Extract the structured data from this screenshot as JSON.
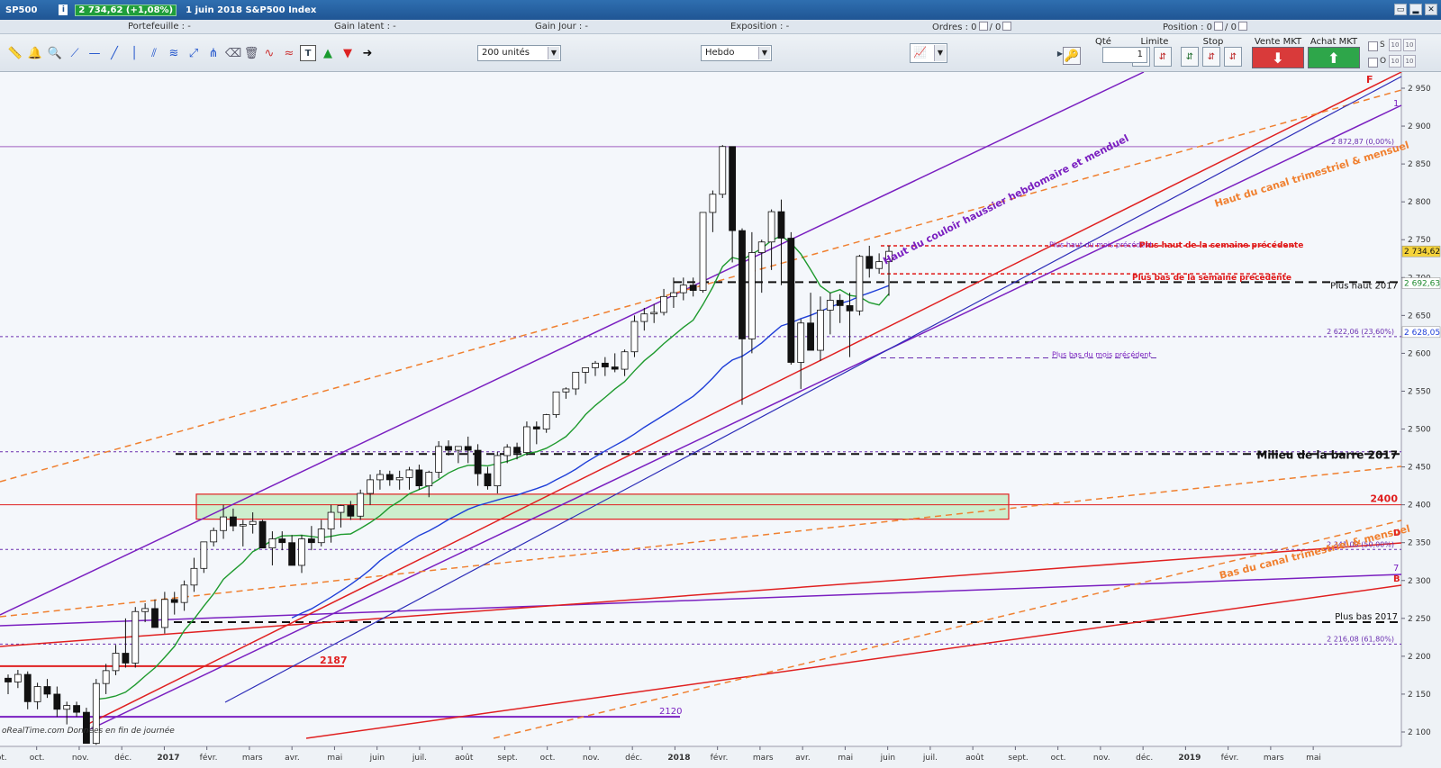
{
  "title_bar": {
    "symbol": "SP500",
    "info_icon": "info-icon",
    "price_badge": "2 734,62 (+1,08%)",
    "description": "1 juin 2018  S&P500 Index",
    "window_buttons": [
      "restore-icon",
      "minimize-icon",
      "close-icon"
    ]
  },
  "stats": {
    "portefeuille": "Portefeuille : -",
    "gain_latent": "Gain latent : -",
    "gain_jour": "Gain Jour : -",
    "exposition": "Exposition : -",
    "ordres_label": "Ordres : 0",
    "ordres_sep": "/ 0",
    "position_label": "Position : 0",
    "position_sep": "/ 0"
  },
  "toolbar": {
    "tools": [
      "ruler-icon",
      "alert-bell-icon",
      "zoom-icon",
      "trendline-icon",
      "horizontal-line-icon",
      "line-icon",
      "vertical-line-icon",
      "parallel-channel-icon",
      "fibonacci-icon",
      "arrows-icon",
      "pitchfork-icon",
      "delete-icon",
      "indicator-icon",
      "waves-icon",
      "text-icon",
      "buy-arrow-icon",
      "sell-arrow-icon",
      "right-arrow-icon"
    ],
    "units_select": "200 unités",
    "period_select": "Hebdo",
    "chart_type_icon": "candlestick-chart-icon",
    "qty_header": "Qté",
    "qty_value": "1",
    "limite_header": "Limite",
    "stop_header": "Stop",
    "vente_header": "Vente MKT",
    "achat_header": "Achat MKT",
    "s_label": "S",
    "o_label": "O",
    "spin_value": "10"
  },
  "chart_data": {
    "type": "candlestick",
    "period": "Hebdo",
    "ylim": [
      2080,
      2970
    ],
    "y_ticks": [
      "2 950",
      "2 900",
      "2 850",
      "2 800",
      "2 750",
      "2 700",
      "2 650",
      "2 600",
      "2 550",
      "2 500",
      "2 450",
      "2 400",
      "2 350",
      "2 300",
      "2 250",
      "2 200",
      "2 150",
      "2 100"
    ],
    "x_ticks": [
      "sept.",
      "oct.",
      "nov.",
      "déc.",
      "2017",
      "févr.",
      "mars",
      "avr.",
      "mai",
      "juin",
      "juil.",
      "août",
      "sept.",
      "oct.",
      "nov.",
      "déc.",
      "2018",
      "févr.",
      "mars",
      "avr.",
      "mai",
      "juin",
      "juil.",
      "août",
      "sept.",
      "oct.",
      "nov.",
      "déc.",
      "2019",
      "févr.",
      "mars",
      "mai"
    ],
    "last_price_label": "2 734,62",
    "ma_green_label": "2 692,63",
    "ma_blue_label": "2 628,05",
    "fibo_labels": {
      "top": "2 872,87 (0,00%)",
      "f236": "2 622,06 (23,60%)",
      "f50": "2 341,00 (50,00%)",
      "f618": "2 216,08 (61,80%)"
    },
    "annotations": {
      "haut_couloir": "Haut du couloir haussier hebdomaire et menduel",
      "haut_canal": "Haut du canal trimestriel & mensuel",
      "bas_canal": "Bas du canal trimestriel & mensuel",
      "plus_haut_semaine": "Plus haut de la semaine précédente",
      "plus_bas_semaine": "Plus bas de la semaine précédente",
      "plus_haut_mois": "Plus haut du mois précédent",
      "plus_bas_mois": "Plus bas du mois précédent",
      "plus_haut_2017": "Plus haut 2017",
      "milieu_barre": "Milieu de la barre 2017",
      "plus_bas_2017": "Plus bas 2017",
      "zone_2400": "2400",
      "level_2187": "2187",
      "level_2120": "2120",
      "letter_f": "F",
      "letter_1": "1",
      "letter_7": "7",
      "letter_b": "B",
      "letter_d": "D"
    },
    "levels": {
      "top_fibo": 2872.87,
      "plus_haut_mois": 2742,
      "plus_haut_semaine": 2742,
      "plus_bas_semaine": 2705,
      "plus_haut_2017": 2694,
      "fibo_236": 2622.06,
      "plus_bas_mois": 2594,
      "milieu_barre": 2467,
      "fibo_dotted_2468": 2470,
      "zone_2400_low": 2381,
      "zone_2400_high": 2414,
      "line_2400": 2400,
      "fibo_50": 2341,
      "plus_bas_2017": 2245,
      "fibo_618": 2216.08,
      "level_2187": 2187,
      "level_2120": 2120
    },
    "candles": [
      [
        2171,
        2176,
        2150,
        2166
      ],
      [
        2166,
        2182,
        2158,
        2176
      ],
      [
        2176,
        2180,
        2130,
        2140
      ],
      [
        2140,
        2165,
        2130,
        2160
      ],
      [
        2160,
        2170,
        2145,
        2150
      ],
      [
        2150,
        2160,
        2120,
        2130
      ],
      [
        2130,
        2140,
        2110,
        2135
      ],
      [
        2135,
        2140,
        2120,
        2126
      ],
      [
        2126,
        2132,
        2100,
        2085
      ],
      [
        2085,
        2170,
        2083,
        2164
      ],
      [
        2164,
        2190,
        2150,
        2181
      ],
      [
        2181,
        2215,
        2175,
        2204
      ],
      [
        2204,
        2250,
        2185,
        2191
      ],
      [
        2191,
        2265,
        2185,
        2259
      ],
      [
        2259,
        2270,
        2245,
        2263
      ],
      [
        2263,
        2275,
        2240,
        2238
      ],
      [
        2238,
        2285,
        2230,
        2275
      ],
      [
        2275,
        2285,
        2255,
        2271
      ],
      [
        2271,
        2300,
        2260,
        2294
      ],
      [
        2294,
        2330,
        2285,
        2316
      ],
      [
        2316,
        2345,
        2310,
        2351
      ],
      [
        2351,
        2370,
        2345,
        2366
      ],
      [
        2366,
        2400,
        2355,
        2384
      ],
      [
        2384,
        2395,
        2365,
        2372
      ],
      [
        2372,
        2380,
        2345,
        2374
      ],
      [
        2374,
        2390,
        2362,
        2378
      ],
      [
        2378,
        2380,
        2350,
        2343
      ],
      [
        2343,
        2365,
        2320,
        2355
      ],
      [
        2355,
        2365,
        2340,
        2350
      ],
      [
        2350,
        2360,
        2320,
        2320
      ],
      [
        2320,
        2360,
        2310,
        2355
      ],
      [
        2355,
        2372,
        2340,
        2350
      ],
      [
        2350,
        2380,
        2345,
        2368
      ],
      [
        2368,
        2400,
        2350,
        2390
      ],
      [
        2390,
        2400,
        2370,
        2399
      ],
      [
        2399,
        2405,
        2380,
        2385
      ],
      [
        2385,
        2420,
        2380,
        2415
      ],
      [
        2415,
        2440,
        2400,
        2433
      ],
      [
        2433,
        2446,
        2420,
        2440
      ],
      [
        2440,
        2445,
        2425,
        2433
      ],
      [
        2433,
        2445,
        2420,
        2436
      ],
      [
        2436,
        2450,
        2420,
        2446
      ],
      [
        2446,
        2453,
        2420,
        2425
      ],
      [
        2425,
        2445,
        2410,
        2443
      ],
      [
        2443,
        2484,
        2435,
        2477
      ],
      [
        2477,
        2485,
        2465,
        2472
      ],
      [
        2472,
        2475,
        2455,
        2477
      ],
      [
        2477,
        2490,
        2455,
        2472
      ],
      [
        2472,
        2480,
        2425,
        2441
      ],
      [
        2441,
        2450,
        2420,
        2425
      ],
      [
        2425,
        2470,
        2415,
        2465
      ],
      [
        2465,
        2480,
        2455,
        2476
      ],
      [
        2476,
        2482,
        2460,
        2469
      ],
      [
        2469,
        2510,
        2465,
        2503
      ],
      [
        2503,
        2510,
        2480,
        2500
      ],
      [
        2500,
        2520,
        2495,
        2519
      ],
      [
        2519,
        2545,
        2515,
        2549
      ],
      [
        2549,
        2555,
        2540,
        2553
      ],
      [
        2553,
        2570,
        2545,
        2575
      ],
      [
        2575,
        2580,
        2560,
        2581
      ],
      [
        2581,
        2590,
        2570,
        2587
      ],
      [
        2587,
        2595,
        2570,
        2582
      ],
      [
        2582,
        2600,
        2575,
        2579
      ],
      [
        2579,
        2605,
        2570,
        2602
      ],
      [
        2602,
        2650,
        2595,
        2642
      ],
      [
        2642,
        2660,
        2630,
        2652
      ],
      [
        2652,
        2665,
        2640,
        2654
      ],
      [
        2654,
        2685,
        2650,
        2675
      ],
      [
        2675,
        2700,
        2660,
        2680
      ],
      [
        2680,
        2700,
        2670,
        2690
      ],
      [
        2690,
        2700,
        2675,
        2683
      ],
      [
        2683,
        2780,
        2680,
        2786
      ],
      [
        2786,
        2815,
        2760,
        2810
      ],
      [
        2810,
        2875,
        2805,
        2873
      ],
      [
        2873,
        2870,
        2720,
        2762
      ],
      [
        2762,
        2765,
        2532,
        2619
      ],
      [
        2619,
        2760,
        2600,
        2733
      ],
      [
        2733,
        2750,
        2680,
        2747
      ],
      [
        2747,
        2790,
        2710,
        2787
      ],
      [
        2787,
        2803,
        2690,
        2752
      ],
      [
        2752,
        2760,
        2585,
        2588
      ],
      [
        2588,
        2645,
        2553,
        2640
      ],
      [
        2640,
        2680,
        2605,
        2604
      ],
      [
        2604,
        2675,
        2590,
        2657
      ],
      [
        2657,
        2680,
        2625,
        2670
      ],
      [
        2670,
        2678,
        2640,
        2663
      ],
      [
        2663,
        2680,
        2595,
        2656
      ],
      [
        2656,
        2730,
        2650,
        2728
      ],
      [
        2728,
        2742,
        2700,
        2712
      ],
      [
        2712,
        2732,
        2705,
        2721
      ],
      [
        2721,
        2742,
        2676,
        2734.62
      ]
    ]
  }
}
